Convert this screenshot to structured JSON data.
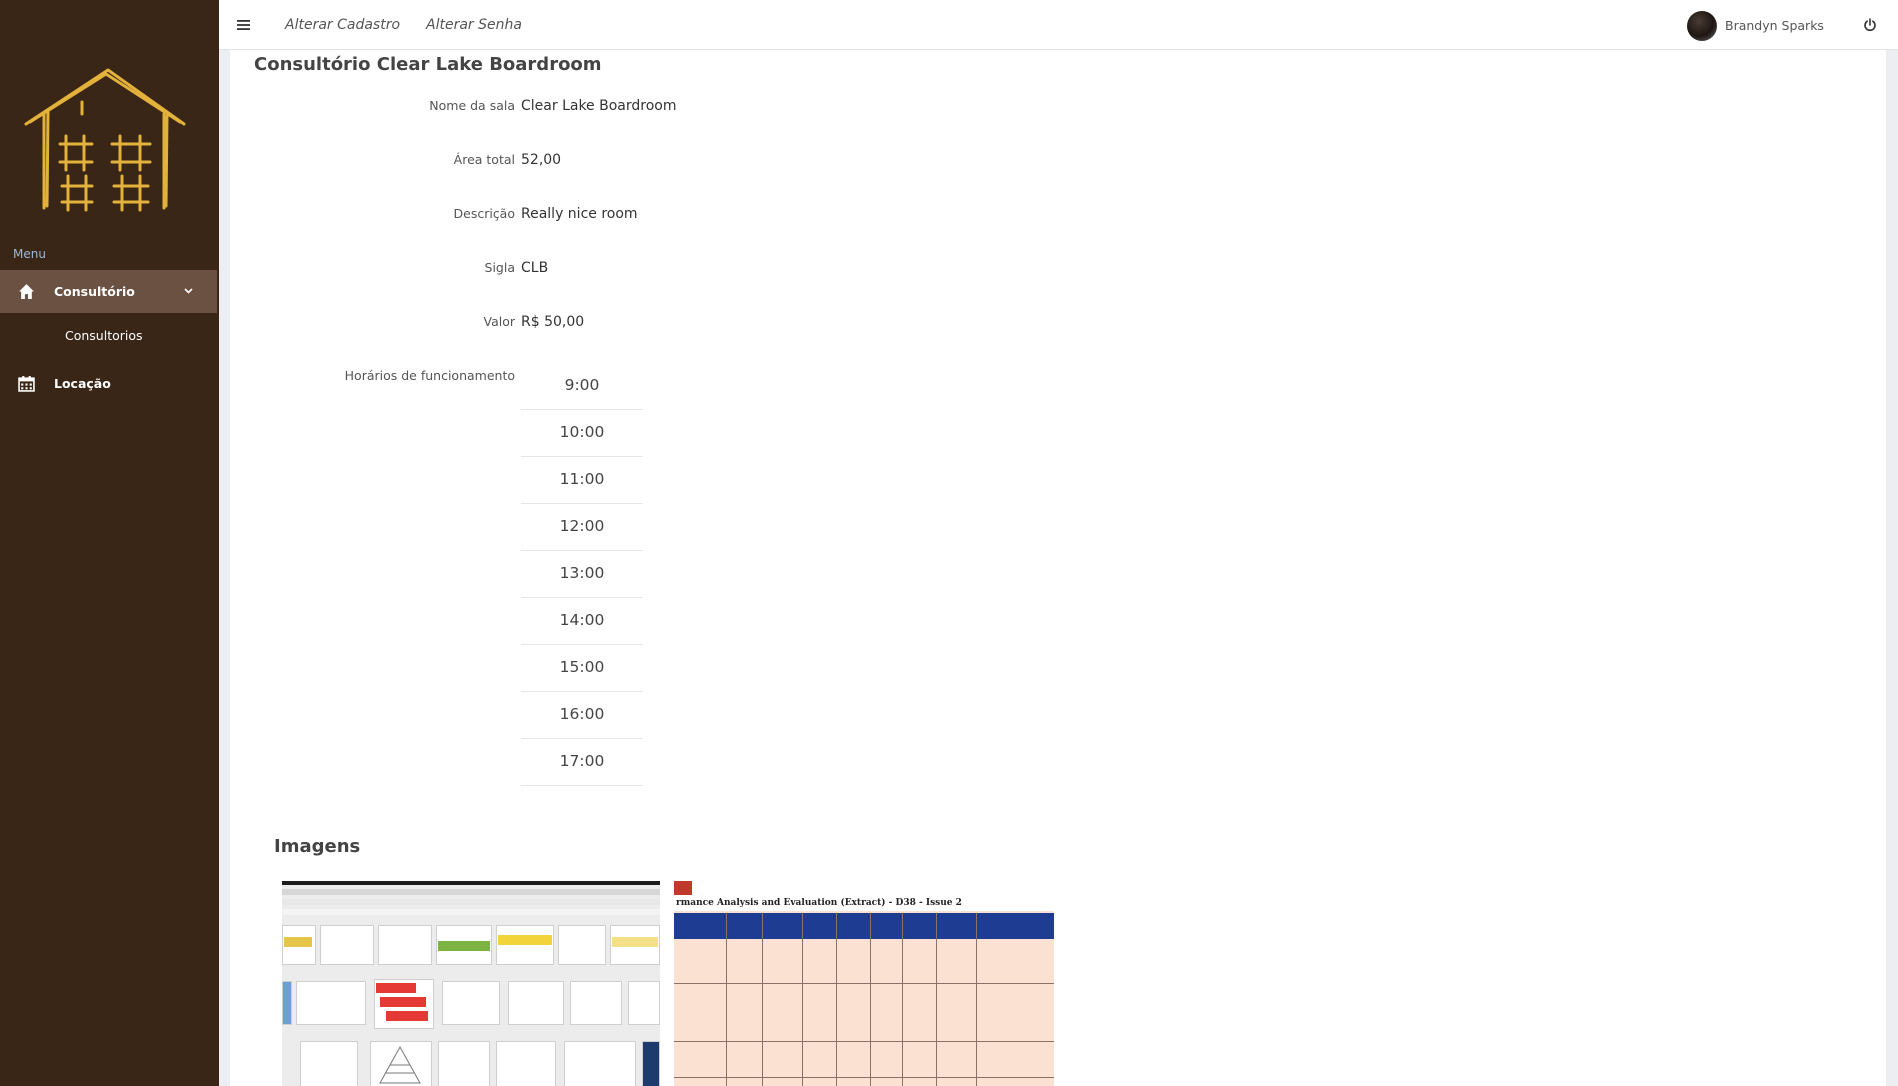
{
  "sidebar": {
    "menu_caption": "Menu",
    "items": [
      {
        "label": "Consultório",
        "icon": "home-icon",
        "active": true
      },
      {
        "label": "Locação",
        "icon": "calendar-icon",
        "active": false
      }
    ],
    "subitems": [
      {
        "label": "Consultorios"
      }
    ],
    "logo_icon": "house-logo-icon"
  },
  "topbar": {
    "menu_icon": "hamburger-icon",
    "links": [
      {
        "label": "Alterar Cadastro"
      },
      {
        "label": "Alterar Senha"
      }
    ],
    "user": {
      "name": "Brandyn Sparks",
      "avatar": "avatar-image"
    },
    "logout_icon": "power-icon"
  },
  "main": {
    "title": "Consultório Clear Lake Boardroom",
    "fields": [
      {
        "label": "Nome da sala",
        "value": "Clear Lake Boardroom"
      },
      {
        "label": "Área total",
        "value": "52,00"
      },
      {
        "label": "Descrição",
        "value": "Really nice room"
      },
      {
        "label": "Sigla",
        "value": "CLB"
      },
      {
        "label": "Valor",
        "value": "R$ 50,00"
      }
    ],
    "hours_label": "Horários de funcionamento",
    "hours": [
      "9:00",
      "10:00",
      "11:00",
      "12:00",
      "13:00",
      "14:00",
      "15:00",
      "16:00",
      "17:00"
    ],
    "images_title": "Imagens",
    "images": [
      {
        "name": "room-image-1"
      },
      {
        "name": "room-image-2",
        "caption": "rmance Analysis and Evaluation (Extract) - D38 - Issue 2"
      }
    ]
  },
  "colors": {
    "sidebar_bg": "#3a2617",
    "sidebar_active": "#6b5142",
    "logo": "#e2b23a",
    "menu_caption": "#9cb6d8"
  }
}
